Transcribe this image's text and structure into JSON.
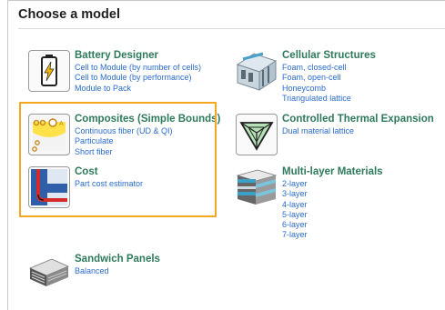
{
  "page": {
    "title": "Choose a model"
  },
  "cards": [
    {
      "title": "Battery Designer",
      "links": [
        "Cell to Module (by number of cells)",
        "Cell to Module (by performance)",
        "Module to Pack"
      ]
    },
    {
      "title": "Cellular Structures",
      "links": [
        "Foam, closed-cell",
        "Foam, open-cell",
        "Honeycomb",
        "Triangulated lattice"
      ]
    },
    {
      "title": "Composites (Simple Bounds)",
      "links": [
        "Continuous fiber (UD & QI)",
        "Particulate",
        "Short fiber"
      ]
    },
    {
      "title": "Controlled Thermal Expansion",
      "links": [
        "Dual material lattice"
      ]
    },
    {
      "title": "Cost",
      "links": [
        "Part cost estimator"
      ]
    },
    {
      "title": "Multi-layer Materials",
      "links": [
        "2-layer",
        "3-layer",
        "4-layer",
        "5-layer",
        "6-layer",
        "7-layer"
      ]
    },
    {
      "title": "Sandwich Panels",
      "links": [
        "Balanced"
      ]
    }
  ],
  "colors": {
    "title_green": "#2e7a5c",
    "link_blue": "#2a6ccf",
    "highlight": "#f5a81f"
  },
  "icons": [
    "battery-icon",
    "cellular-structures-icon",
    "composites-icon",
    "thermal-expansion-icon",
    "cost-icon",
    "multilayer-icon",
    "sandwich-panel-icon"
  ]
}
